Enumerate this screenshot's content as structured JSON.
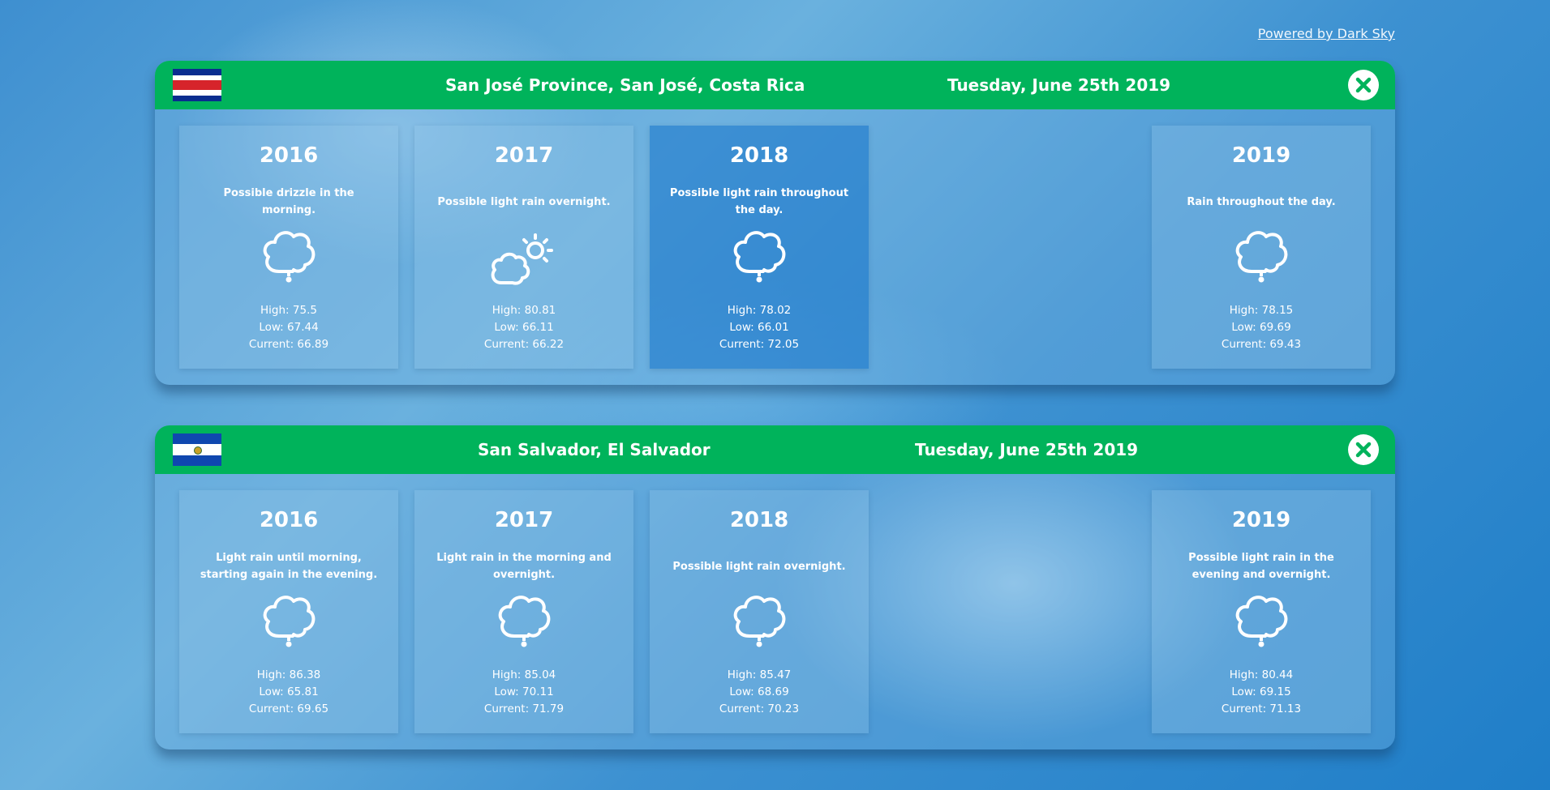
{
  "powered_by": "Powered by Dark Sky",
  "locations": [
    {
      "flag_icon": "costa-rica-flag-icon",
      "name": "San José Province, San José, Costa Rica",
      "date": "Tuesday, June 25th 2019",
      "close_icon": "close-x-icon",
      "years": [
        {
          "year": "2016",
          "summary": "Possible drizzle in the morning.",
          "icon": "drizzle-icon",
          "high": "High: 75.5",
          "low": "Low: 67.44",
          "current": "Current: 66.89"
        },
        {
          "year": "2017",
          "summary": "Possible light rain overnight.",
          "icon": "partly-cloudy-day-icon",
          "high": "High: 80.81",
          "low": "Low: 66.11",
          "current": "Current: 66.22"
        },
        {
          "year": "2018",
          "summary": "Possible light rain throughout the day.",
          "icon": "rain-cloud-icon",
          "high": "High: 78.02",
          "low": "Low: 66.01",
          "current": "Current: 72.05"
        },
        {
          "year": "2019",
          "summary": "Rain throughout the day.",
          "icon": "rain-cloud-icon",
          "high": "High: 78.15",
          "low": "Low: 69.69",
          "current": "Current: 69.43"
        }
      ]
    },
    {
      "flag_icon": "el-salvador-flag-icon",
      "name": "San Salvador, El Salvador",
      "date": "Tuesday, June 25th 2019",
      "close_icon": "close-x-icon",
      "years": [
        {
          "year": "2016",
          "summary": "Light rain until morning, starting again in the evening.",
          "icon": "rain-cloud-icon",
          "high": "High: 86.38",
          "low": "Low: 65.81",
          "current": "Current: 69.65"
        },
        {
          "year": "2017",
          "summary": "Light rain in the morning and overnight.",
          "icon": "rain-cloud-icon",
          "high": "High: 85.04",
          "low": "Low: 70.11",
          "current": "Current: 71.79"
        },
        {
          "year": "2018",
          "summary": "Possible light rain overnight.",
          "icon": "rain-cloud-icon",
          "high": "High: 85.47",
          "low": "Low: 68.69",
          "current": "Current: 70.23"
        },
        {
          "year": "2019",
          "summary": "Possible light rain in the evening and overnight.",
          "icon": "rain-cloud-icon",
          "high": "High: 80.44",
          "low": "Low: 69.15",
          "current": "Current: 71.13"
        }
      ]
    }
  ],
  "colors": {
    "header_green": "#00b35b",
    "close_x_green": "#00b35b"
  }
}
